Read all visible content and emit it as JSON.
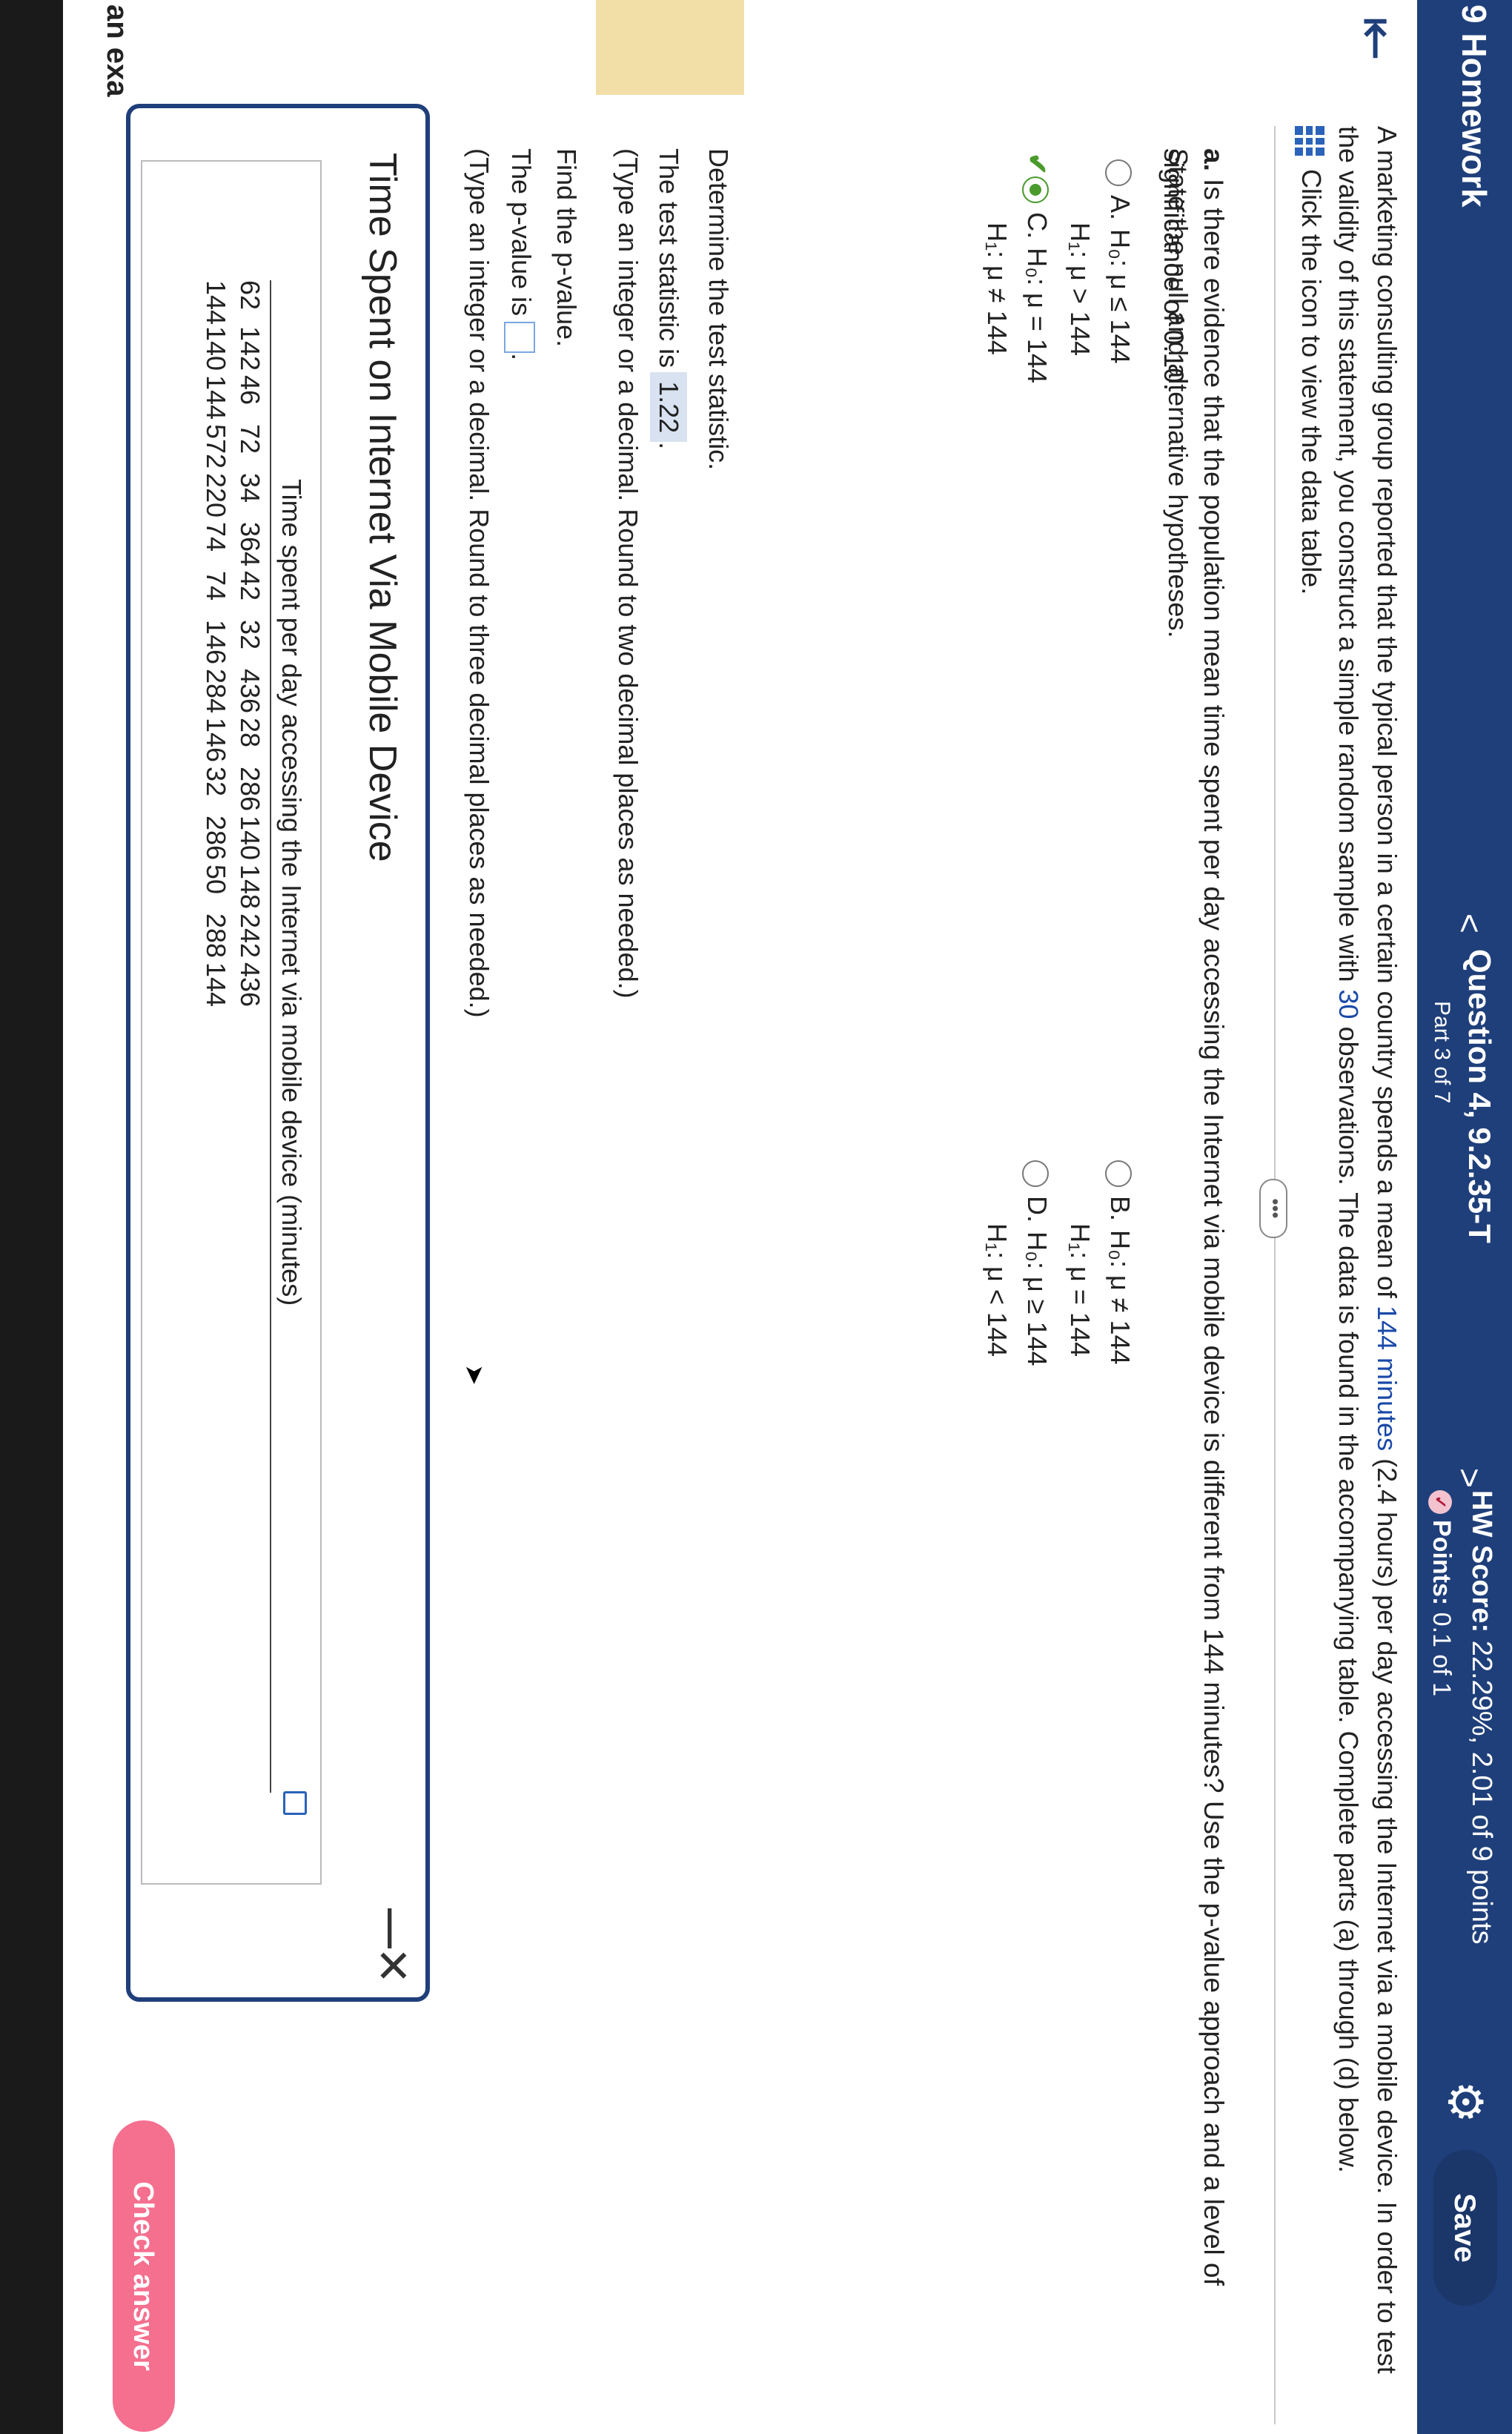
{
  "header": {
    "homework_title": "9 Homework",
    "question_title": "Question 4, 9.2.35-T",
    "question_part": "Part 3 of 7",
    "hw_score_label": "HW Score:",
    "hw_score_value": "22.29%, 2.01 of 9 points",
    "points_label": "Points:",
    "points_value": "0.1 of 1",
    "save_label": "Save",
    "prev_glyph": "<",
    "next_glyph": ">"
  },
  "problem": {
    "intro_1": "A marketing consulting group reported that the typical person in a certain country spends a mean of",
    "intro_mean": "144 minutes",
    "intro_2": "(2.4 hours) per day accessing the Internet via a mobile device. In order to test the validity of this statement, you construct a simple random sample with",
    "intro_n": "30",
    "intro_3": "observations. The data is found in the accompanying table. Complete parts (a) through (d) below.",
    "data_link": "Click the icon to view the data table."
  },
  "part_a": {
    "question_prefix": "a.",
    "question": "Is there evidence that the population mean time spent per day accessing the Internet via mobile device is different from 144 minutes? Use the p-value approach and a level of significance of 0.10.",
    "instruction": "State the null and alternative hypotheses.",
    "options": [
      {
        "letter": "A.",
        "h0": "H₀: μ ≤ 144",
        "h1": "H₁: μ > 144"
      },
      {
        "letter": "B.",
        "h0": "H₀: μ ≠ 144",
        "h1": "H₁: μ = 144"
      },
      {
        "letter": "C.",
        "h0": "H₀: μ = 144",
        "h1": "H₁: μ ≠ 144"
      },
      {
        "letter": "D.",
        "h0": "H₀: μ ≥ 144",
        "h1": "H₁: μ < 144"
      }
    ],
    "selected_option": "C.",
    "test_stat_heading": "Determine the test statistic.",
    "test_stat_prefix": "The test statistic is",
    "test_stat_value": "1.22",
    "test_stat_instruction": "(Type an integer or a decimal. Round to two decimal places as needed.)",
    "pvalue_heading": "Find the p-value.",
    "pvalue_prefix": "The p-value is",
    "pvalue_value": "",
    "pvalue_instruction": "(Type an integer or a decimal. Round to three decimal places as needed.)"
  },
  "popup": {
    "title": "Time Spent on Internet Via Mobile Device",
    "minimize_glyph": "—",
    "close_glyph": "✕",
    "table_caption": "Time spent per day accessing the Internet via mobile device (minutes)",
    "rows": [
      [
        "62",
        "142",
        "46",
        "72",
        "34",
        "364",
        "42",
        "32",
        "436",
        "28",
        "286",
        "140",
        "148",
        "242",
        "436"
      ],
      [
        "144",
        "140",
        "144",
        "572",
        "220",
        "74",
        "74",
        "146",
        "284",
        "146",
        "32",
        "286",
        "50",
        "288",
        "144"
      ]
    ]
  },
  "side": {
    "fragment": "an exa"
  },
  "footer": {
    "check_answer_label": "Check answer"
  },
  "colors": {
    "header_bg": "#1f3f7a",
    "link_blue": "#1a4aa8",
    "selected_green": "#4a9a2c",
    "check_answer_pink": "#f56f8f"
  }
}
